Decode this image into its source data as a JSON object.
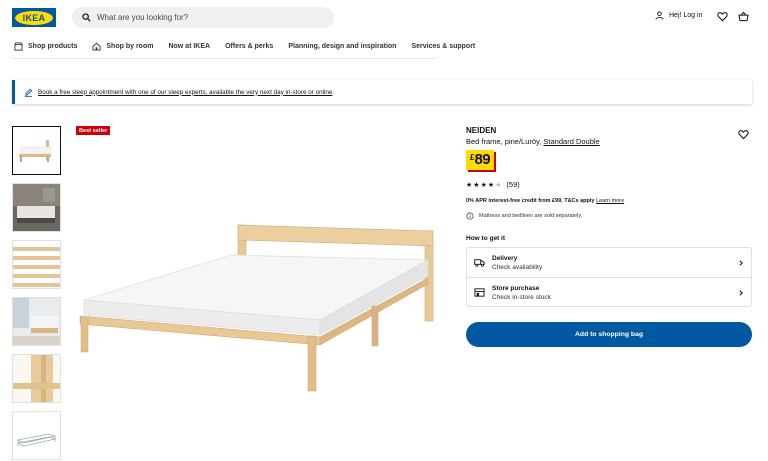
{
  "header": {
    "logo_text": "IKEA",
    "search_placeholder": "What are you looking for?",
    "login_label": "Hej! Log in",
    "icons": [
      "search-icon",
      "user-icon",
      "heart-icon",
      "shopping-bag-icon"
    ]
  },
  "nav": {
    "items": [
      {
        "label": "Shop products",
        "icon": "shop-icon"
      },
      {
        "label": "Shop by room",
        "icon": "home-icon"
      },
      {
        "label": "Now at IKEA"
      },
      {
        "label": "Offers & perks"
      },
      {
        "label": "Planning, design and inspiration"
      },
      {
        "label": "Services & support"
      }
    ]
  },
  "banner": {
    "text": "Book a free sleep appointment with one of our sleep experts, available the very next day in-store or online"
  },
  "gallery": {
    "badge": "Best seller",
    "thumbnails": [
      "bed-frame",
      "bedroom-scene",
      "slats",
      "room-scene",
      "headboard-detail",
      "line-drawing"
    ]
  },
  "product": {
    "name": "NEIDEN",
    "description": "Bed frame, pine/Luröy,",
    "size_link": "Standard Double",
    "price_currency": "£",
    "price_amount": "89",
    "rating_stars": 4,
    "rating_count": "(59)",
    "credit_text": "0% APR interest-free credit from £99, T&Cs apply",
    "credit_link": "Learn more",
    "note": "Mattress and bedlinen are sold separately.",
    "how_to_get": "How to get it",
    "delivery_title": "Delivery",
    "delivery_sub": "Check availability",
    "store_title": "Store purchase",
    "store_sub": "Check in-store stock",
    "add_button": "Add to shopping bag"
  },
  "colors": {
    "ikea_blue": "#0058a3",
    "ikea_yellow": "#ffdb00",
    "badge_red": "#cc0008"
  }
}
